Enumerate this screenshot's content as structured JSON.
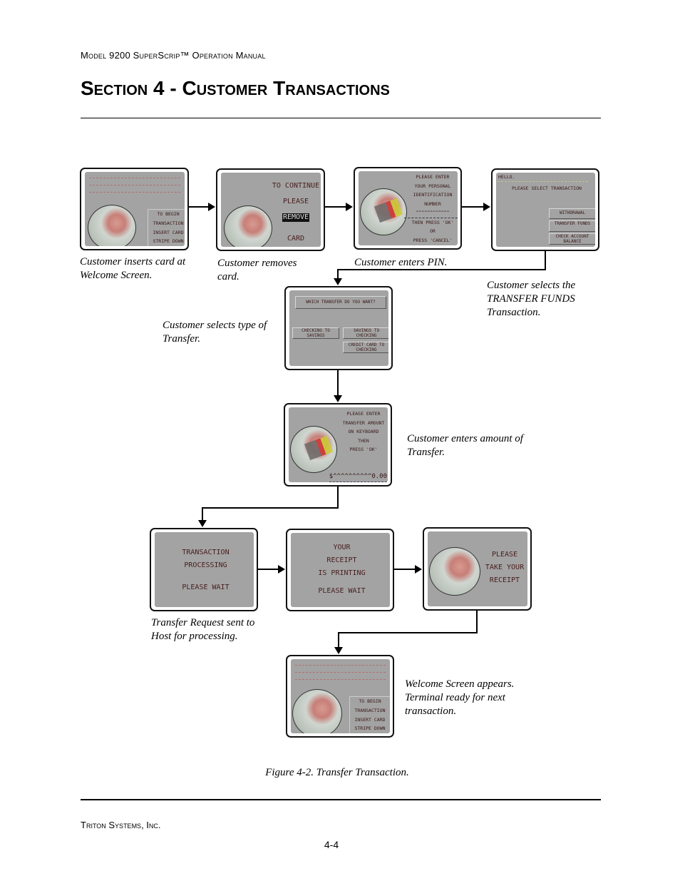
{
  "header": {
    "running_title": "Model 9200 SuperScrip™ Operation Manual",
    "section_title": "Section 4 - Customer Transactions"
  },
  "screens": {
    "welcome": {
      "lines": [
        "TO BEGIN",
        "TRANSACTION",
        "INSERT CARD",
        "STRIPE DOWN"
      ]
    },
    "remove": {
      "lines": [
        "TO CONTINUE",
        "PLEASE",
        "REMOVE",
        "CARD"
      ]
    },
    "pin": {
      "lines": [
        "PLEASE ENTER",
        "YOUR PERSONAL",
        "IDENTIFICATION",
        "NUMBER",
        "^^^^^^^^^^^^",
        "THEN PRESS 'OK'",
        "OR",
        "PRESS 'CANCEL'"
      ]
    },
    "select": {
      "greeting": "HELLO.",
      "prompt": "PLEASE SELECT TRANSACTION",
      "buttons": [
        "WITHDRAWAL",
        "TRANSFER FUNDS",
        "CHECK ACCOUNT BALANCE"
      ]
    },
    "transfer_type": {
      "prompt": "WHICH TRANSFER DO YOU WANT?",
      "buttons": [
        "CHECKING TO SAVINGS",
        "SAVINGS TO CHECKING",
        "CREDIT CARD TO CHECKING"
      ]
    },
    "amount": {
      "lines": [
        "PLEASE ENTER",
        "TRANSFER AMOUNT",
        "ON KEYBOARD",
        "THEN",
        "PRESS 'OK'"
      ],
      "amount_field": "$^^^^^^^^^^0.00"
    },
    "processing": {
      "lines": [
        "TRANSACTION",
        "PROCESSING",
        "PLEASE WAIT"
      ]
    },
    "printing": {
      "lines": [
        "YOUR",
        "RECEIPT",
        "IS PRINTING",
        "PLEASE WAIT"
      ]
    },
    "take_receipt": {
      "lines": [
        "PLEASE",
        "TAKE YOUR",
        "RECEIPT"
      ]
    },
    "welcome_again": {
      "lines": [
        "TO BEGIN",
        "TRANSACTION",
        "INSERT CARD",
        "STRIPE DOWN"
      ]
    }
  },
  "captions": {
    "c1": "Customer inserts card at Welcome Screen.",
    "c2": "Customer removes card.",
    "c3": "Customer enters PIN.",
    "c4": "Customer selects the TRANSFER FUNDS Transaction.",
    "c5": "Customer selects type of Transfer.",
    "c6": "Customer enters amount of Transfer.",
    "c7": "Transfer Request sent to Host for processing.",
    "c8": "Welcome Screen appears. Terminal ready for next transaction."
  },
  "figure_caption": "Figure 4-2. Transfer Transaction.",
  "footer": {
    "company": "Triton Systems, Inc.",
    "page_number": "4-4"
  }
}
